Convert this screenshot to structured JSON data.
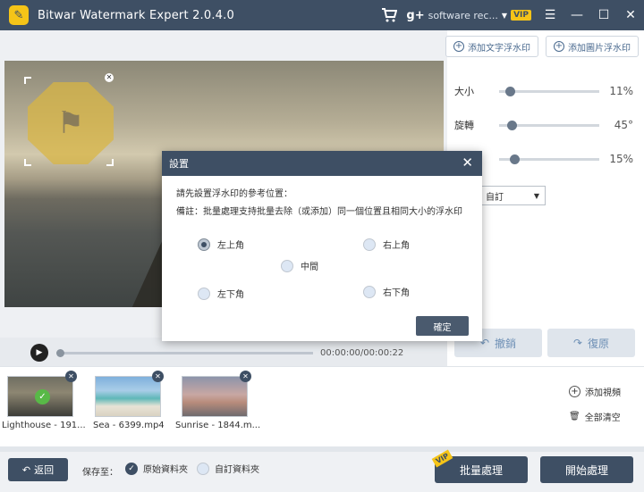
{
  "app": {
    "title": "Bitwar Watermark Expert  2.0.4.0",
    "software_rec": "software rec...",
    "vip": "VIP"
  },
  "toolbar": {
    "add_text_watermark": "添加文字浮水印",
    "add_image_watermark": "添加圖片浮水印"
  },
  "settings": {
    "size_label": "大小",
    "size_value": "11%",
    "size_level": 0.11,
    "rotate_label": "旋轉",
    "rotate_value": "45°",
    "rotate_level": 0.125,
    "opacity_value": "15%",
    "opacity_level": 0.15,
    "position_select": "自訂"
  },
  "actions": {
    "undo": "撤銷",
    "redo": "復原"
  },
  "player": {
    "time": "00:00:00/00:00:22",
    "progress": 0
  },
  "files": [
    {
      "name": "Lighthouse - 191...",
      "selected": true
    },
    {
      "name": "Sea - 6399.mp4",
      "selected": false
    },
    {
      "name": "Sunrise - 1844.m...",
      "selected": false
    }
  ],
  "file_actions": {
    "add_video": "添加視頻",
    "clear_all": "全部清空"
  },
  "bottom": {
    "back": "返回",
    "save_to": "保存至：",
    "original_folder": "原始資料夾",
    "custom_folder": "自訂資料夾",
    "batch": "批量處理",
    "batch_vip": "VIP",
    "start": "開始處理"
  },
  "dialog": {
    "title": "設置",
    "prompt": "請先設置浮水印的參考位置：",
    "note": "備註：批量處理支持批量去除（或添加）同一個位置且相同大小的浮水印",
    "top_left": "左上角",
    "top_right": "右上角",
    "center": "中間",
    "bottom_left": "左下角",
    "bottom_right": "右下角",
    "selected": "top_left",
    "ok": "確定"
  },
  "colors": {
    "titlebar": "#3e4f64",
    "accent_yellow": "#f5c418",
    "check_green": "#58b947"
  }
}
